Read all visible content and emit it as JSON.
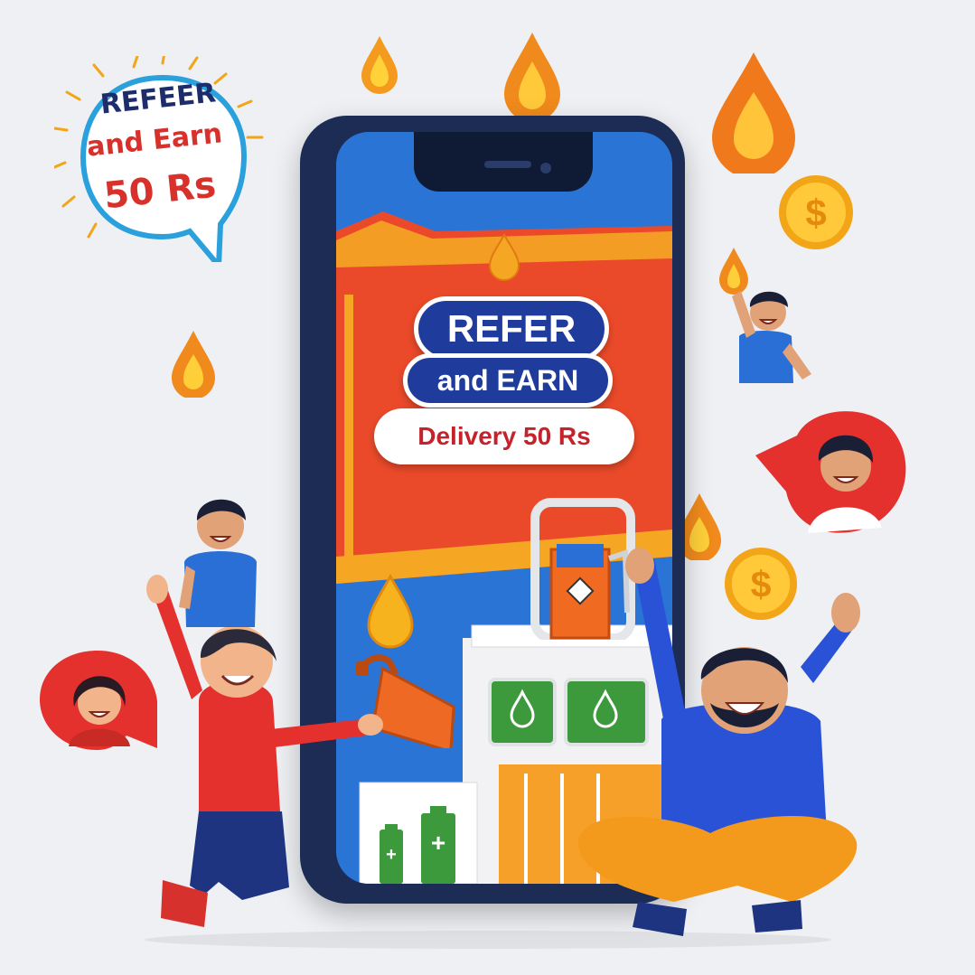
{
  "promo_bubble": {
    "line1": "REFEER",
    "line2": "and Earn",
    "line3": "50 Rs"
  },
  "phone_screen": {
    "headline": "REFER",
    "subheadline": "and EARN",
    "delivery_label": "Delivery 50 Rs"
  },
  "icons": [
    "fuel-drop-icon",
    "dollar-coin-icon",
    "fuel-pump-icon",
    "jerry-can-icon",
    "battery-icon"
  ],
  "colors": {
    "background": "#eef0f4",
    "primary_blue": "#1f3c9c",
    "accent_red": "#e0322b",
    "accent_orange": "#f5a623"
  }
}
